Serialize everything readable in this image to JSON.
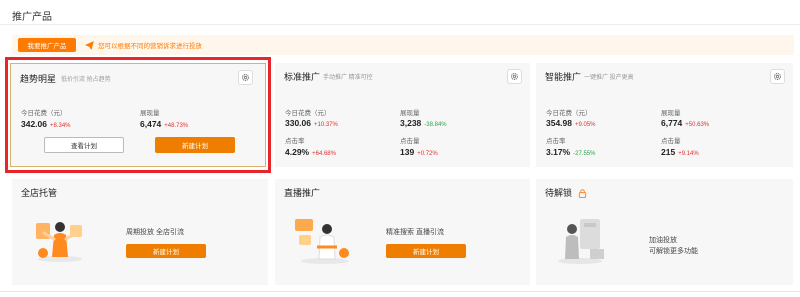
{
  "page": {
    "title": "推广产品"
  },
  "promo": {
    "button_label": "我要推广产品",
    "tip": "您可以根据不同的营销诉求进行投放"
  },
  "cards": {
    "trend": {
      "title": "趋势明星",
      "subtitle": "低价引流 抢占趋势",
      "metrics": [
        {
          "label": "今日花费（元）",
          "value": "342.06",
          "change": "+8.34%",
          "dir": "up"
        },
        {
          "label": "展现量",
          "value": "6,474",
          "change": "+48.73%",
          "dir": "up"
        }
      ],
      "view_label": "查看计划",
      "new_label": "新建计划"
    },
    "standard": {
      "title": "标准推广",
      "subtitle": "手动推广 精准可控",
      "metrics": [
        {
          "label": "今日花费（元）",
          "value": "330.06",
          "change": "+10.37%",
          "dir": "up"
        },
        {
          "label": "展现量",
          "value": "3,238",
          "change": "-38.84%",
          "dir": "down"
        },
        {
          "label": "点击率",
          "value": "4.29%",
          "change": "+64.68%",
          "dir": "up"
        },
        {
          "label": "点击量",
          "value": "139",
          "change": "+0.72%",
          "dir": "up"
        }
      ]
    },
    "smart": {
      "title": "智能推广",
      "subtitle": "一键推广 投产更高",
      "metrics": [
        {
          "label": "今日花费（元）",
          "value": "354.98",
          "change": "+9.05%",
          "dir": "up"
        },
        {
          "label": "展现量",
          "value": "6,774",
          "change": "+50.63%",
          "dir": "up"
        },
        {
          "label": "点击率",
          "value": "3.17%",
          "change": "-27.55%",
          "dir": "down"
        },
        {
          "label": "点击量",
          "value": "215",
          "change": "+9.14%",
          "dir": "up"
        }
      ]
    },
    "store": {
      "title": "全店托管",
      "desc": "周期投放 全店引流",
      "new_label": "新建计划"
    },
    "live": {
      "title": "直播推广",
      "desc": "精准搜索 直播引流",
      "new_label": "新建计划"
    },
    "unlock": {
      "title": "待解锁",
      "desc_line1": "加油投放",
      "desc_line2": "可解锁更多功能"
    }
  },
  "colors": {
    "accent": "#ee7d00",
    "up": "#e02e2e",
    "down": "#2ba444",
    "highlight": "#e8252a"
  }
}
